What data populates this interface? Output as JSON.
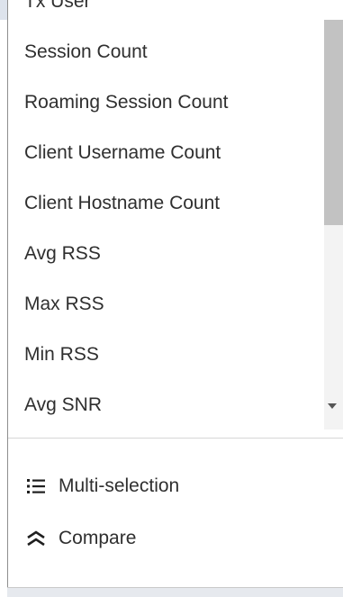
{
  "dropdown": {
    "items": [
      "Tx User",
      "Session Count",
      "Roaming Session Count",
      "Client Username Count",
      "Client Hostname Count",
      "Avg RSS",
      "Max RSS",
      "Min RSS",
      "Avg SNR"
    ]
  },
  "actions": {
    "multi_selection": {
      "label": "Multi-selection",
      "icon": "list-icon"
    },
    "compare": {
      "label": "Compare",
      "icon": "compare-icon"
    }
  }
}
